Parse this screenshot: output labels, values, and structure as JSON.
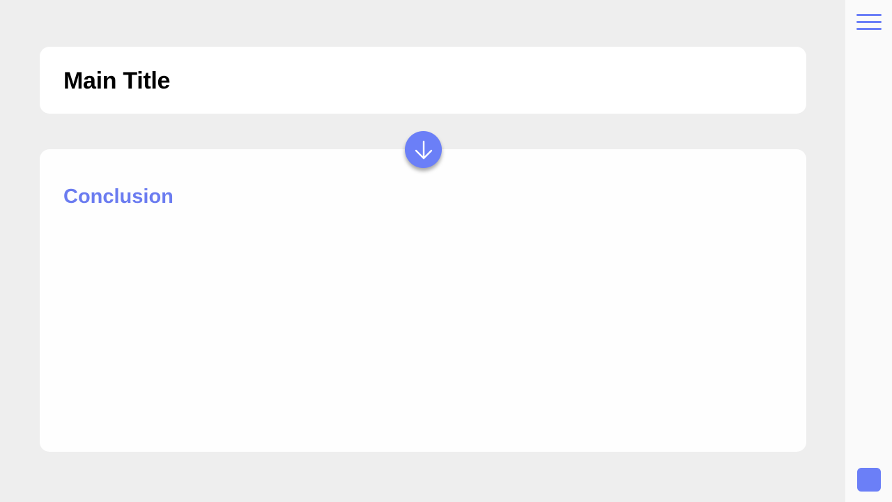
{
  "header": {
    "title": "Main Title"
  },
  "section": {
    "heading": "Conclusion"
  },
  "controls": {
    "scroll_down_icon": "arrow-down-icon",
    "menu_icon": "hamburger-menu-icon",
    "square_button_icon": "square-icon"
  },
  "colors": {
    "accent": "#6b7ff7",
    "heading_accent": "#6b7cf0",
    "background": "#eeeeee",
    "card": "#ffffff",
    "sidebar": "#fafafa"
  }
}
